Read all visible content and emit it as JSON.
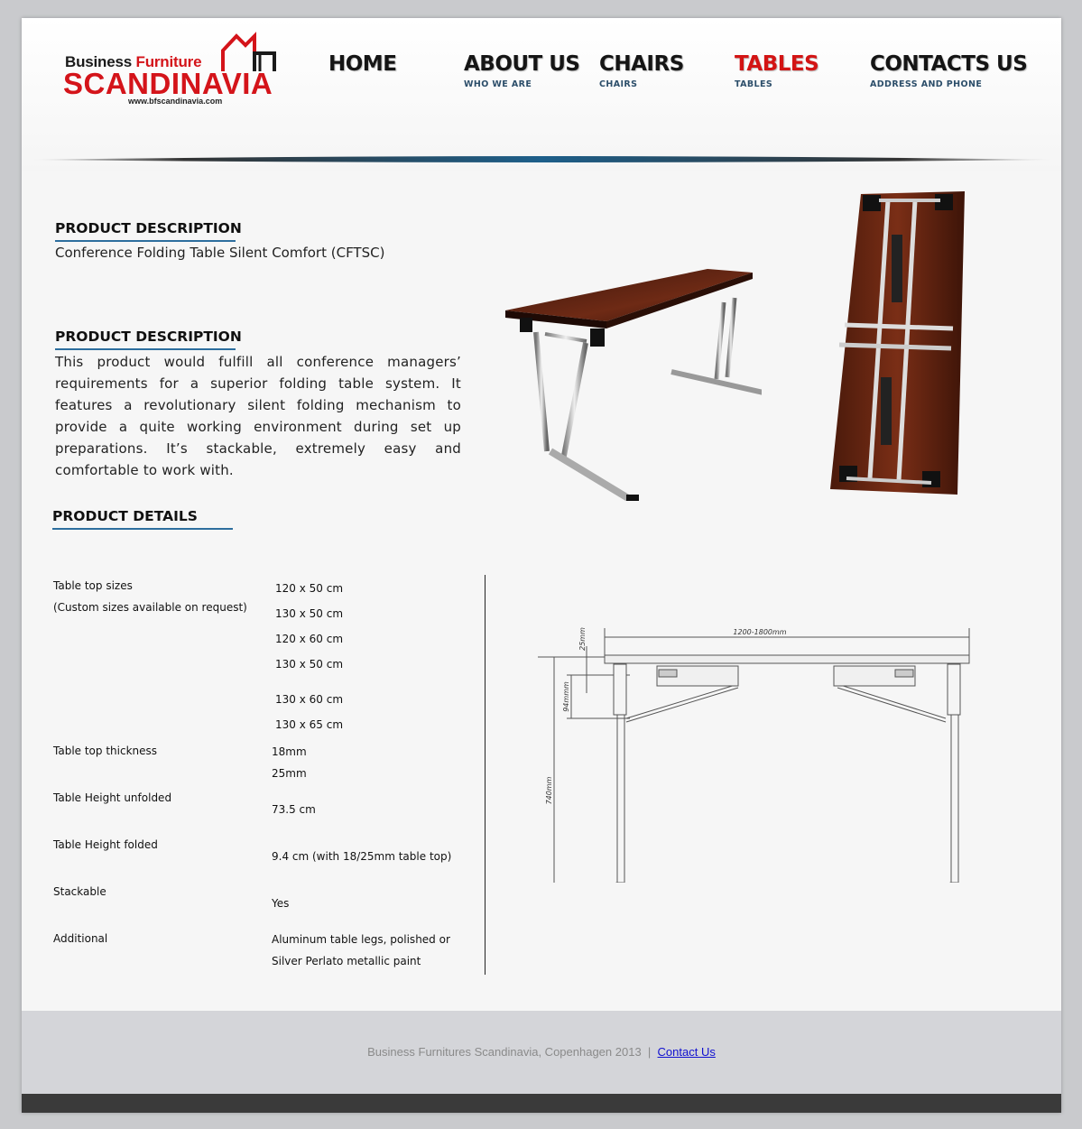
{
  "logo": {
    "line1_a": "Business ",
    "line1_b": "Furniture",
    "line2": "SCANDINAVIA",
    "url": "www.bfscandinavia.com"
  },
  "nav": {
    "items": [
      {
        "label": "HOME",
        "sub": ""
      },
      {
        "label": "ABOUT US",
        "sub": "WHO WE ARE"
      },
      {
        "label": "CHAIRS",
        "sub": "CHAIRS"
      },
      {
        "label": "TABLES",
        "sub": "TABLES",
        "active": true
      },
      {
        "label": "CONTACTS US",
        "sub": "ADDRESS AND PHONE"
      }
    ]
  },
  "sections": {
    "product_desc_1": {
      "heading": "PRODUCT DESCRIPTION",
      "text": "Conference Folding Table Silent Comfort (CFTSC)"
    },
    "product_desc_2": {
      "heading": "PRODUCT DESCRIPTION",
      "text": "This product would fulfill all conference managers’ requirements for a superior folding table system. It features a revolutionary silent folding mechanism to provide a quite working environment during set up preparations. It’s stackable, extremely easy and comfortable to work with."
    },
    "details": {
      "heading": "PRODUCT DETAILS",
      "labels": {
        "top_sizes": "Table top sizes",
        "custom": "(Custom sizes available on request)",
        "thickness": "Table top thickness",
        "height_unfolded": "Table Height unfolded",
        "height_folded": "Table Height folded",
        "stackable": "Stackable",
        "additional": "Additional"
      },
      "values": {
        "sizes": [
          "120 x 50 cm",
          "130 x 50 cm",
          "120 x 60 cm",
          "130 x 50 cm",
          "130 x 60 cm",
          "130 x 65 cm"
        ],
        "thickness": [
          "18mm",
          "25mm"
        ],
        "height_unfolded": "73.5 cm",
        "height_folded": "9.4 cm (with 18/25mm table top)",
        "stackable": "Yes",
        "additional_1": "Aluminum table legs, polished or",
        "additional_2": "Silver Perlato metallic paint"
      }
    }
  },
  "drawing": {
    "width_label": "1200-1800mm",
    "top_label": "25mm",
    "fold_label": "94mmm",
    "height_label": "740mm"
  },
  "footer": {
    "text": "Business Furnitures Scandinavia, Copenhagen 2013",
    "separator": "|",
    "link": "Contact Us"
  },
  "colors": {
    "accent_red": "#d31414",
    "underline_blue": "#2d6e9e",
    "wood": "#5a1f10"
  }
}
